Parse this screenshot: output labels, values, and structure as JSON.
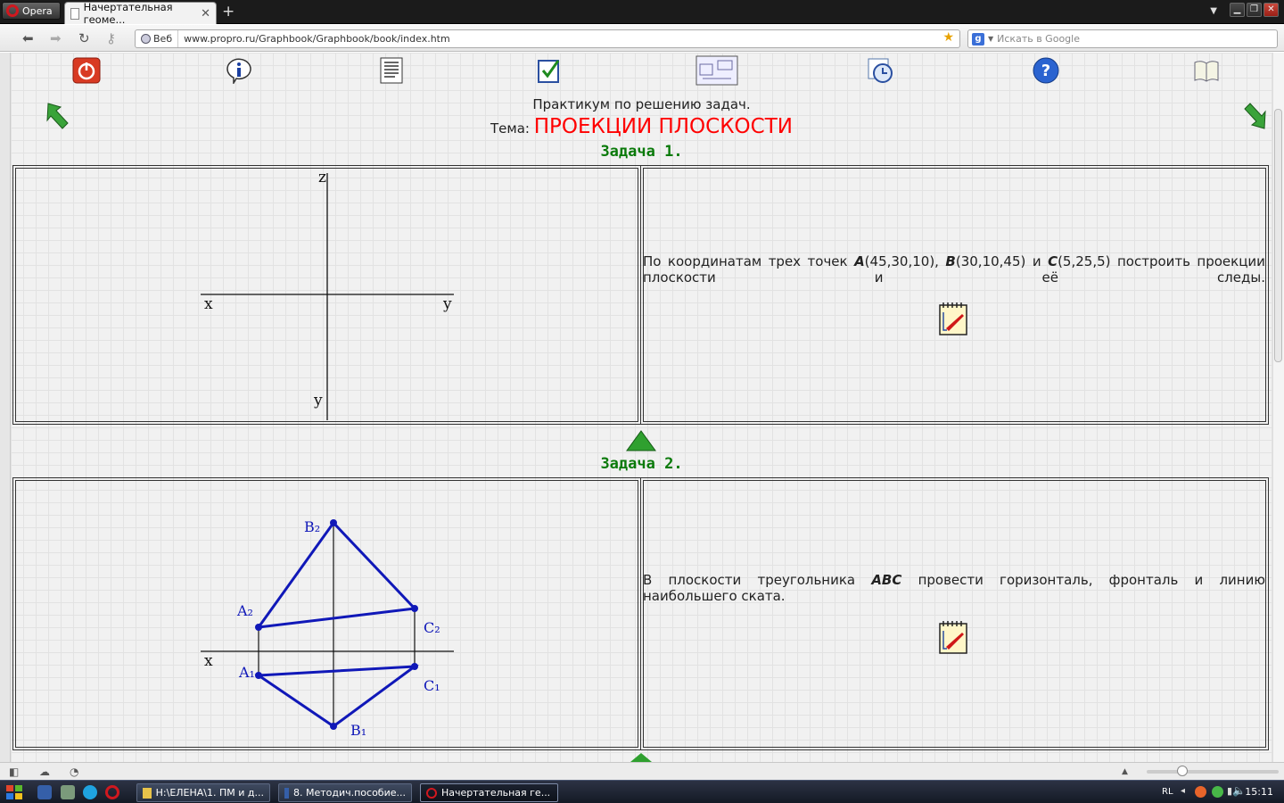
{
  "browser": {
    "menu_label": "Opera",
    "tab_title": "Начертательная геоме...",
    "web_badge": "Веб",
    "url": "www.propro.ru/Graphbook/Graphbook/book/index.htm",
    "search_placeholder": "Искать в Google"
  },
  "page": {
    "heading_line1": "Практикум по решению задач.",
    "theme_prefix": "Тема:",
    "theme_title": "ПРОЕКЦИИ ПЛОСКОСТИ",
    "nav_icons": [
      "power-icon",
      "info-icon",
      "document-icon",
      "checklist-icon",
      "drawing-icon",
      "clock-icon",
      "help-icon",
      "book-icon"
    ],
    "tasks": [
      {
        "title": "Задача 1.",
        "text_before": "По координатам трех точек",
        "text_parts": [
          {
            "label": "A",
            "coords": "(45,30,10),"
          },
          {
            "label": "B",
            "coords": "(30,10,45)"
          },
          {
            "label": "C",
            "coords": "(5,25,5)"
          }
        ],
        "and_word": "и",
        "text_after": "построить проекции плоскости и её следы.",
        "axis_labels": {
          "z": "z",
          "x": "x",
          "y_right": "y",
          "y_bottom": "y"
        }
      },
      {
        "title": "Задача 2.",
        "text_before": "В плоскости треугольника",
        "text_italic": "ABC",
        "text_after": "провести горизонталь, фронталь и линию наибольшего ската.",
        "axis_labels": {
          "x": "x"
        },
        "point_labels": {
          "B2": "B₂",
          "A2": "A₂",
          "C2": "C₂",
          "A1": "A₁",
          "C1": "C₁",
          "B1": "B₁"
        }
      }
    ],
    "accent_colors": {
      "theme": "#ff0000",
      "task_title": "#0a7a0a",
      "drawing": "#1018b8"
    }
  },
  "taskbar": {
    "items": [
      "H:\\ЕЛЕНА\\1. ПМ и д...",
      "8. Методич.пособие...",
      "Начертательная ге..."
    ],
    "lang": "RL",
    "clock": "15:11"
  }
}
